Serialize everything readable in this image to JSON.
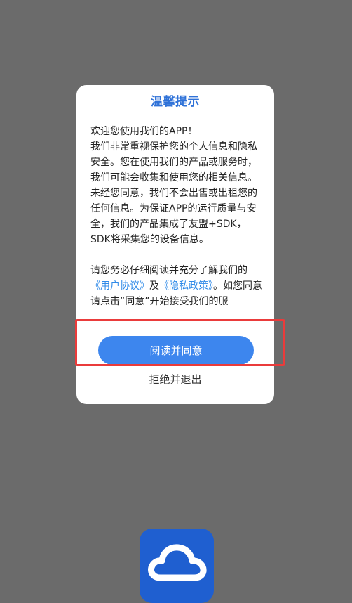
{
  "dialog": {
    "title": "温馨提示",
    "paragraph1": "欢迎您使用我们的APP！\n我们非常重视保护您的个人信息和隐私安全。您在使用我们的产品或服务时，我们可能会收集和使用您的相关信息。未经您同意，我们不会出售或出租您的任何信息。为保证APP的运行质量与安全，我们的产品集成了友盟+SDK，SDK将采集您的设备信息。",
    "paragraph2_prefix": "请您务必仔细阅读并充分了解我们的",
    "user_agreement_link": "《用户协议》",
    "conjunction": "及",
    "privacy_policy_link": "《隐私政策》",
    "paragraph2_suffix": "。如您同意请点击“同意”开始接受我们的服",
    "agree_button_label": "阅读并同意",
    "reject_label": "拒绝并退出"
  },
  "colors": {
    "overlay": "#6b6b6b",
    "title": "#2f72d8",
    "link": "#2f8ae8",
    "button": "#3d86ee",
    "highlight": "#ea3b3b",
    "app_icon": "#1f5fd0"
  },
  "icons": {
    "app_icon": "cloud-icon"
  }
}
